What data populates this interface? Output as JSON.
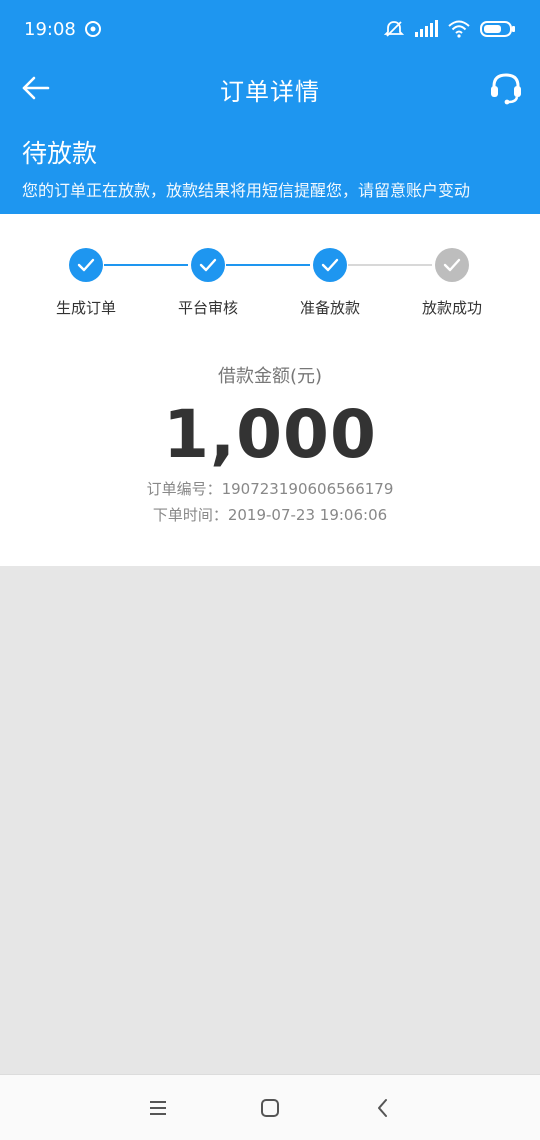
{
  "status_bar": {
    "time": "19:08",
    "icons": [
      "sync-icon",
      "alarm-off-icon",
      "signal-icon",
      "wifi-icon",
      "battery-icon"
    ]
  },
  "nav": {
    "title": "订单详情",
    "back_icon": "back-arrow-icon",
    "service_icon": "headset-icon"
  },
  "banner": {
    "title": "待放款",
    "description": "您的订单正在放款，放款结果将用短信提醒您，请留意账户变动"
  },
  "steps": [
    {
      "label": "生成订单",
      "done": true
    },
    {
      "label": "平台审核",
      "done": true
    },
    {
      "label": "准备放款",
      "done": true
    },
    {
      "label": "放款成功",
      "done": false
    }
  ],
  "amount": {
    "label": "借款金额(元)",
    "value": "1,000"
  },
  "order": {
    "number_line": "订单编号：190723190606566179",
    "time_line": "下单时间：2019-07-23 19:06:06"
  },
  "colors": {
    "accent": "#1e96f0",
    "step_done": "#1e96f0",
    "step_pending": "#bdbdbd",
    "page_bg": "#e6e6e6"
  },
  "bottom_nav": {
    "icons": [
      "menu-icon",
      "home-icon",
      "back-icon"
    ]
  }
}
